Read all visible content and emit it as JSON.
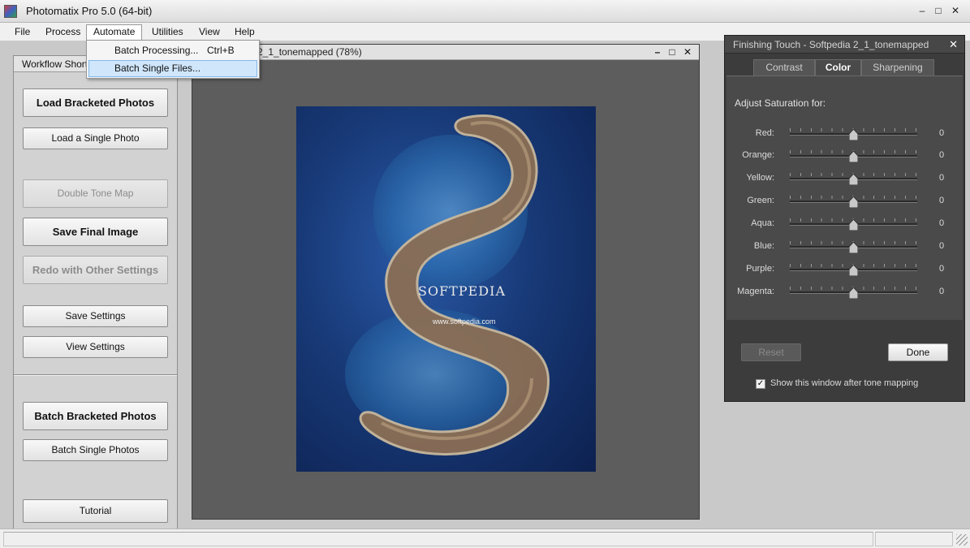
{
  "window": {
    "title": "Photomatix Pro 5.0 (64-bit)",
    "controls": [
      "minimize",
      "maximize",
      "close"
    ]
  },
  "menubar": {
    "items": [
      "File",
      "Process",
      "Automate",
      "Utilities",
      "View",
      "Help"
    ],
    "active": "Automate"
  },
  "automate_menu": {
    "items": [
      {
        "label": "Batch Processing...",
        "shortcut": "Ctrl+B"
      },
      {
        "label": "Batch Single Files...",
        "shortcut": ""
      }
    ],
    "highlighted": "Batch Single Files..."
  },
  "workflow": {
    "tab_label": "Workflow Shortcuts",
    "buttons": {
      "load_bracketed": "Load Bracketed Photos",
      "load_single": "Load a Single Photo",
      "double_tone_map": "Double Tone Map",
      "save_final": "Save Final Image",
      "redo": "Redo with Other Settings",
      "save_settings": "Save Settings",
      "view_settings": "View Settings",
      "batch_bracketed": "Batch Bracketed Photos",
      "batch_single": "Batch Single Photos",
      "tutorial": "Tutorial"
    },
    "disabled": [
      "Double Tone Map",
      "Redo with Other Settings"
    ]
  },
  "image_window": {
    "title": "2_1_tonemapped (78%)",
    "watermark_text": "SOFTPEDIA",
    "watermark_url": "www.softpedia.com"
  },
  "finishing_touch": {
    "title": "Finishing Touch - Softpedia 2_1_tonemapped",
    "tabs": [
      "Contrast",
      "Color",
      "Sharpening"
    ],
    "active_tab": "Color",
    "heading": "Adjust Saturation for:",
    "sliders": [
      {
        "label": "Red:",
        "value": "0"
      },
      {
        "label": "Orange:",
        "value": "0"
      },
      {
        "label": "Yellow:",
        "value": "0"
      },
      {
        "label": "Green:",
        "value": "0"
      },
      {
        "label": "Aqua:",
        "value": "0"
      },
      {
        "label": "Blue:",
        "value": "0"
      },
      {
        "label": "Purple:",
        "value": "0"
      },
      {
        "label": "Magenta:",
        "value": "0"
      }
    ],
    "reset_label": "Reset",
    "done_label": "Done",
    "checkbox_label": "Show this window after tone mapping",
    "checkbox_checked": true
  },
  "colors": {
    "panel_dark": "#3c3c3c",
    "menu_highlight": "#cfe6fb",
    "image_bg": "#5d5d5d"
  }
}
